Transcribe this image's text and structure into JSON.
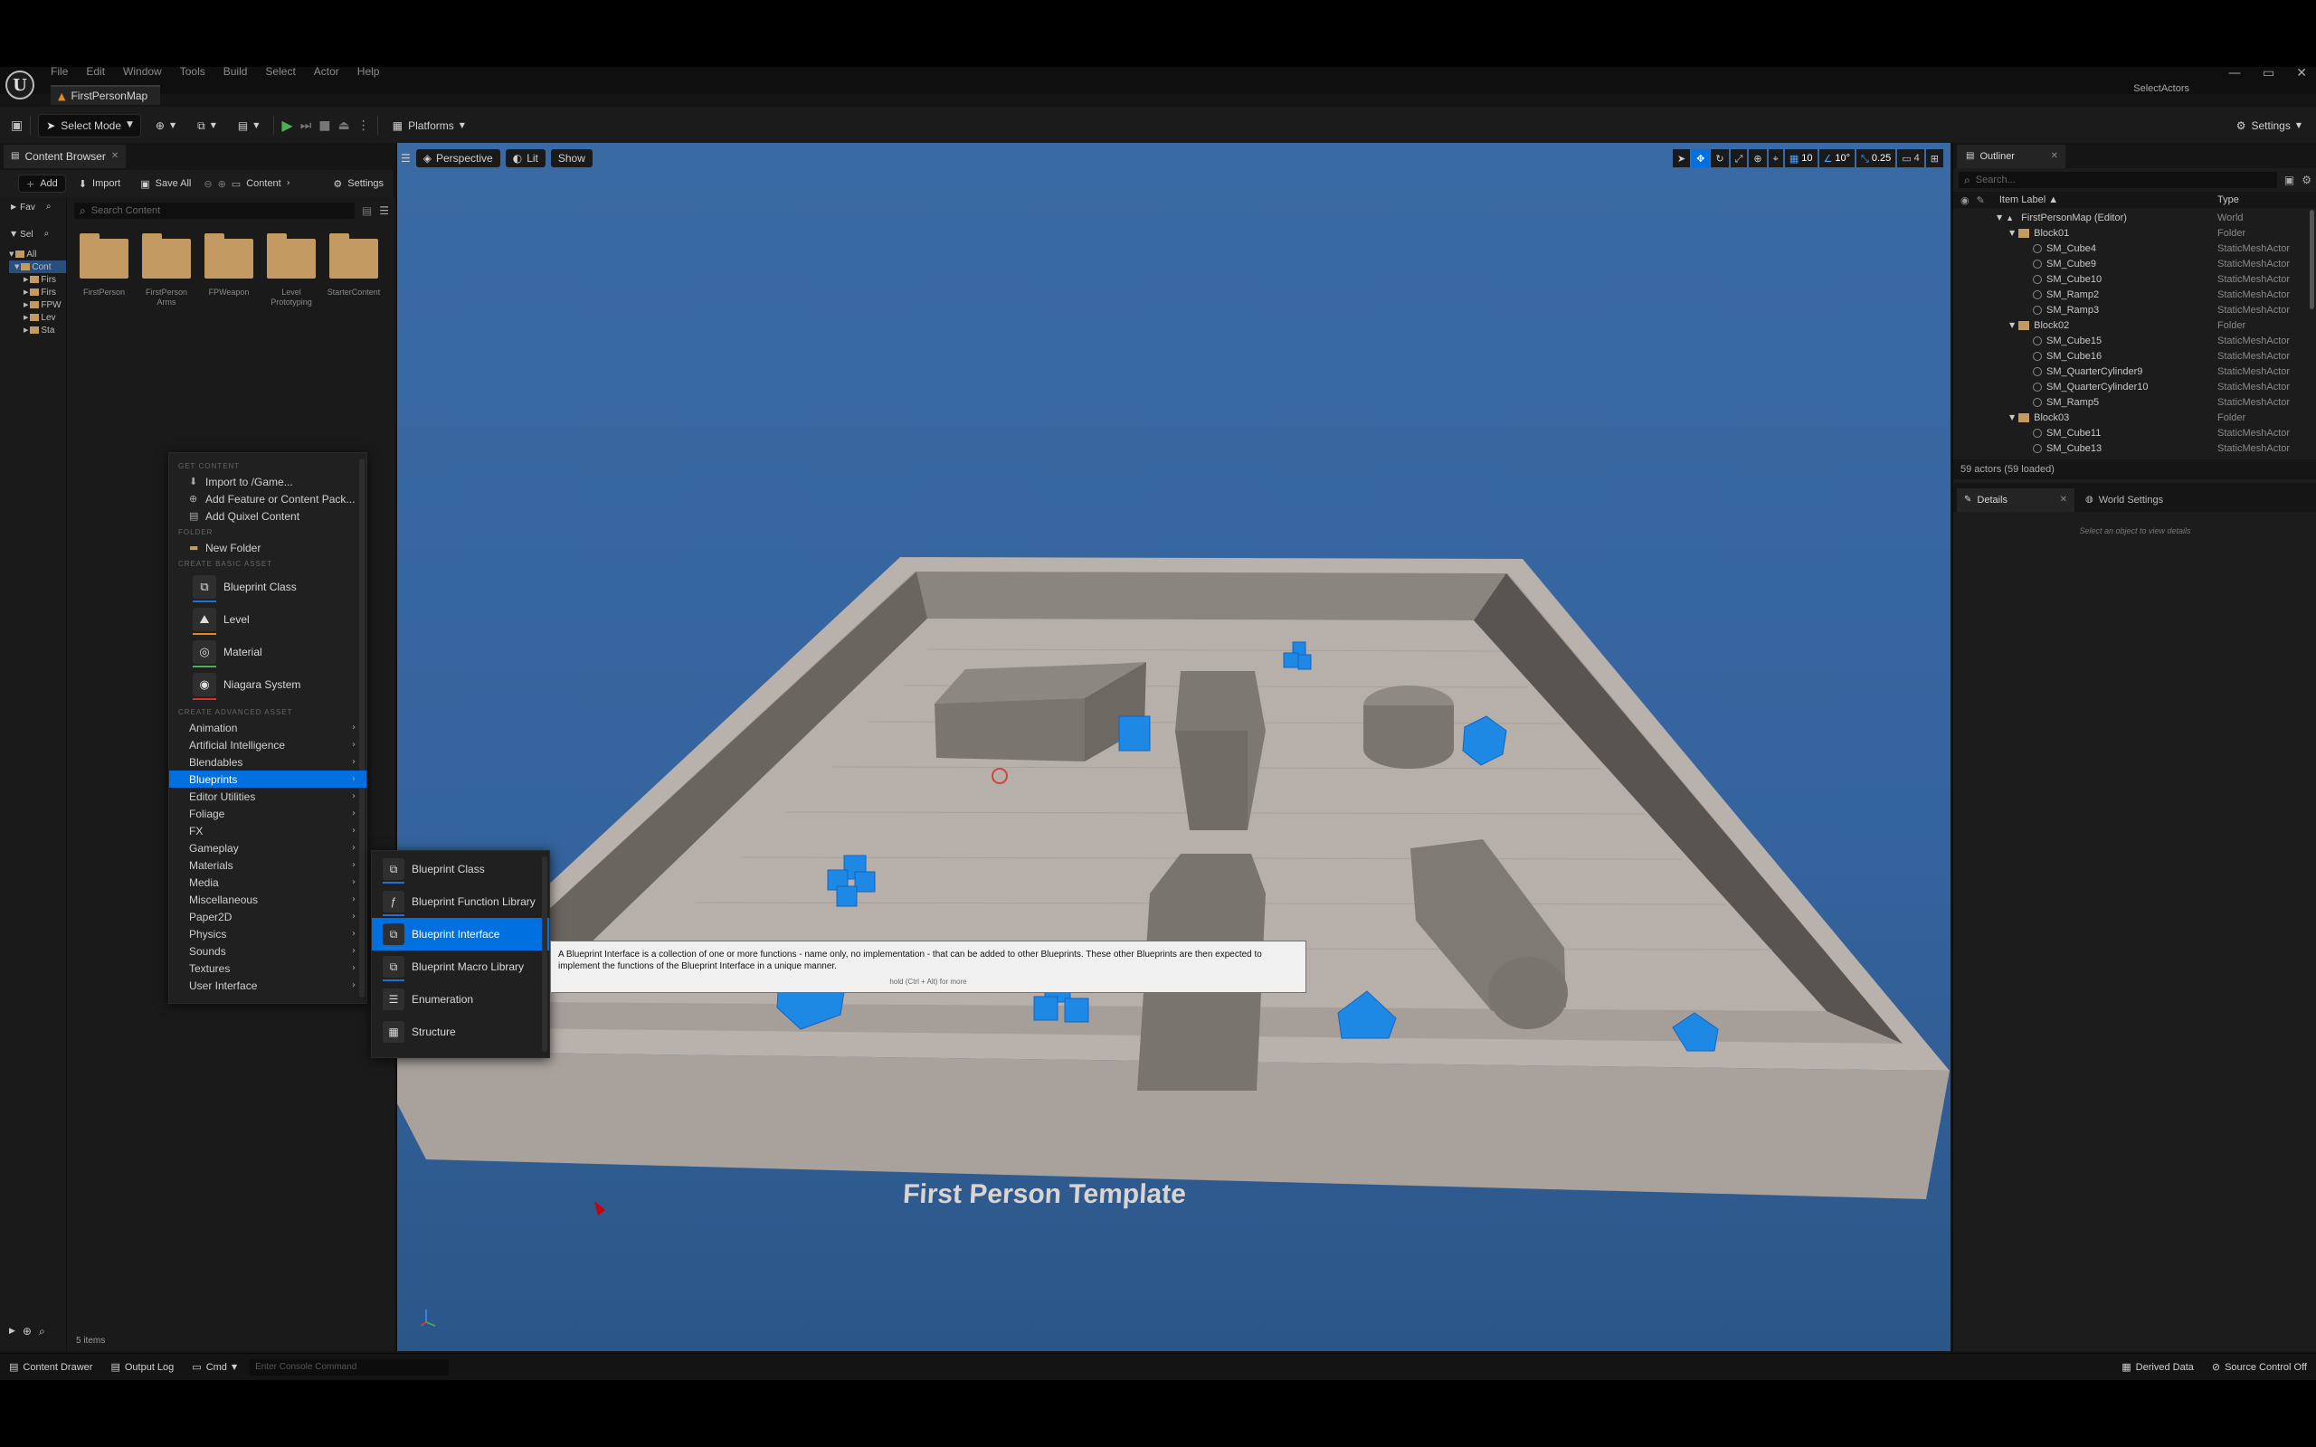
{
  "menubar": {
    "items": [
      "File",
      "Edit",
      "Window",
      "Tools",
      "Build",
      "Select",
      "Actor",
      "Help"
    ],
    "window_controls": [
      "—",
      "▭",
      "✕"
    ]
  },
  "doc_tab": {
    "title": "FirstPersonMap"
  },
  "select_actors_label": "SelectActors",
  "toolbar": {
    "select_mode": "Select Mode",
    "platforms": "Platforms",
    "settings": "Settings"
  },
  "content_browser": {
    "tab_title": "Content Browser",
    "add": "Add",
    "import": "Import",
    "save_all": "Save All",
    "breadcrumb": "Content",
    "settings": "Settings",
    "favorites_stub": "Fav",
    "sel_stub": "Sel",
    "search_placeholder": "Search Content",
    "tree": [
      "All",
      "Cont",
      "Firs",
      "Firs",
      "FPW",
      "Lev",
      "Sta"
    ],
    "folders": [
      "FirstPerson",
      "FirstPerson Arms",
      "FPWeapon",
      "Level Prototyping",
      "StarterContent"
    ],
    "item_count": "5 items"
  },
  "context_menu": {
    "headers": {
      "get_content": "GET CONTENT",
      "folder": "FOLDER",
      "basic": "CREATE BASIC ASSET",
      "advanced": "CREATE ADVANCED ASSET"
    },
    "get_content_items": [
      "Import to /Game...",
      "Add Feature or Content Pack...",
      "Add Quixel Content"
    ],
    "new_folder": "New Folder",
    "basic_assets": [
      "Blueprint Class",
      "Level",
      "Material",
      "Niagara System"
    ],
    "advanced_assets": [
      "Animation",
      "Artificial Intelligence",
      "Blendables",
      "Blueprints",
      "Editor Utilities",
      "Foliage",
      "FX",
      "Gameplay",
      "Materials",
      "Media",
      "Miscellaneous",
      "Paper2D",
      "Physics",
      "Sounds",
      "Textures",
      "User Interface"
    ]
  },
  "submenu": {
    "items": [
      "Blueprint Class",
      "Blueprint Function Library",
      "Blueprint Interface",
      "Blueprint Macro Library",
      "Enumeration",
      "Structure"
    ]
  },
  "tooltip": {
    "text": "A Blueprint Interface is a collection of one or more functions - name only, no implementation - that can be added to other Blueprints. These other Blueprints are then expected to implement the functions of the Blueprint Interface in a unique manner.",
    "hint": "hold (Ctrl + Alt) for more"
  },
  "viewport": {
    "perspective": "Perspective",
    "lit": "Lit",
    "show": "Show",
    "grid_snap": "10",
    "rot_snap": "10°",
    "scale_snap": "0.25",
    "cam_speed": "4",
    "floor_text": "First Person Template"
  },
  "outliner": {
    "tab_title": "Outliner",
    "search_placeholder": "Search...",
    "col_label": "Item Label ▲",
    "col_type": "Type",
    "rows": [
      {
        "label": "FirstPersonMap (Editor)",
        "type": "World",
        "kind": "world",
        "indent": 0
      },
      {
        "label": "Block01",
        "type": "Folder",
        "kind": "folder",
        "indent": 1
      },
      {
        "label": "SM_Cube4",
        "type": "StaticMeshActor",
        "kind": "mesh",
        "indent": 2
      },
      {
        "label": "SM_Cube9",
        "type": "StaticMeshActor",
        "kind": "mesh",
        "indent": 2
      },
      {
        "label": "SM_Cube10",
        "type": "StaticMeshActor",
        "kind": "mesh",
        "indent": 2
      },
      {
        "label": "SM_Ramp2",
        "type": "StaticMeshActor",
        "kind": "mesh",
        "indent": 2
      },
      {
        "label": "SM_Ramp3",
        "type": "StaticMeshActor",
        "kind": "mesh",
        "indent": 2
      },
      {
        "label": "Block02",
        "type": "Folder",
        "kind": "folder",
        "indent": 1
      },
      {
        "label": "SM_Cube15",
        "type": "StaticMeshActor",
        "kind": "mesh",
        "indent": 2
      },
      {
        "label": "SM_Cube16",
        "type": "StaticMeshActor",
        "kind": "mesh",
        "indent": 2
      },
      {
        "label": "SM_QuarterCylinder9",
        "type": "StaticMeshActor",
        "kind": "mesh",
        "indent": 2
      },
      {
        "label": "SM_QuarterCylinder10",
        "type": "StaticMeshActor",
        "kind": "mesh",
        "indent": 2
      },
      {
        "label": "SM_Ramp5",
        "type": "StaticMeshActor",
        "kind": "mesh",
        "indent": 2
      },
      {
        "label": "Block03",
        "type": "Folder",
        "kind": "folder",
        "indent": 1
      },
      {
        "label": "SM_Cube11",
        "type": "StaticMeshActor",
        "kind": "mesh",
        "indent": 2
      },
      {
        "label": "SM_Cube13",
        "type": "StaticMeshActor",
        "kind": "mesh",
        "indent": 2
      }
    ],
    "footer": "59 actors (59 loaded)"
  },
  "details": {
    "tab_title": "Details",
    "world_settings": "World Settings",
    "empty_msg": "Select an object to view details"
  },
  "statusbar": {
    "content_drawer": "Content Drawer",
    "output_log": "Output Log",
    "cmd": "Cmd",
    "console_placeholder": "Enter Console Command",
    "derived_data": "Derived Data",
    "source_control": "Source Control Off"
  },
  "colors": {
    "accent": "#0070e0",
    "folder": "#c29a62",
    "sky": "#3a6aa3",
    "cube": "#1e88e5"
  }
}
